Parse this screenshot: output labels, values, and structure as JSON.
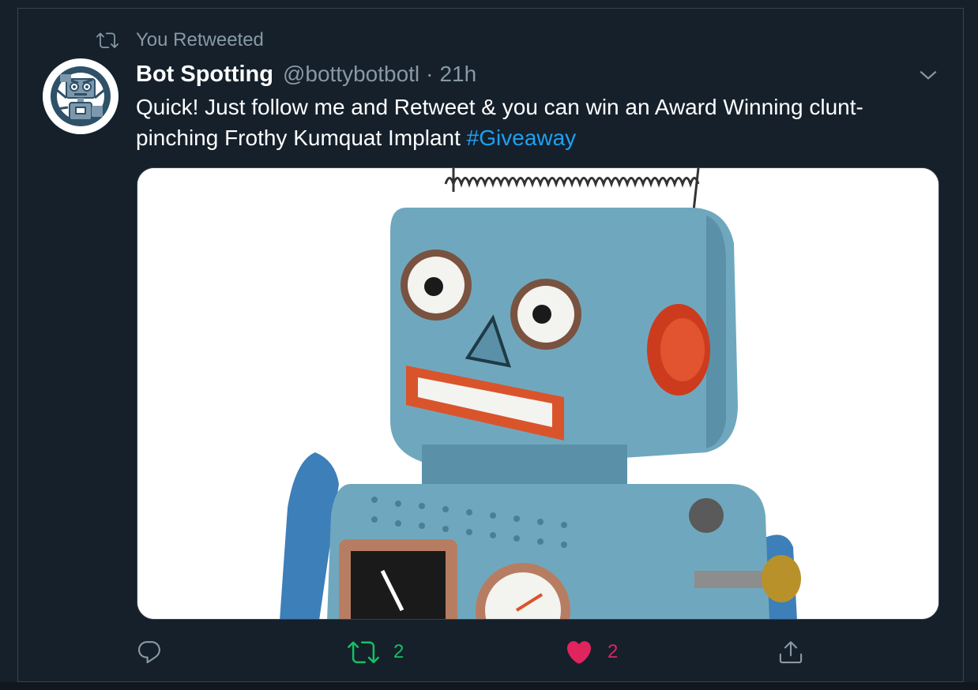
{
  "retweet_context": {
    "icon": "retweet-icon",
    "label": "You Retweeted"
  },
  "tweet": {
    "author_name": "Bot Spotting",
    "author_handle": "@bottybotbotl",
    "separator": "·",
    "time": "21h",
    "text_plain": "Quick! Just follow me and Retweet & you can win an Award Winning clunt-pinching Frothy Kumquat Implant ",
    "hashtag": "#Giveaway",
    "media_description_icon": "toy-robot-image",
    "avatar_icon": "robot-avatar"
  },
  "actions": {
    "reply_icon": "reply-icon",
    "retweet_icon": "retweet-icon",
    "retweet_count": "2",
    "like_icon": "heart-icon",
    "like_count": "2",
    "share_icon": "share-icon"
  },
  "colors": {
    "background": "#15202b",
    "secondary_text": "#8899a6",
    "link": "#1da1f2",
    "retweet_active": "#17bf63",
    "like_active": "#e0245e"
  }
}
